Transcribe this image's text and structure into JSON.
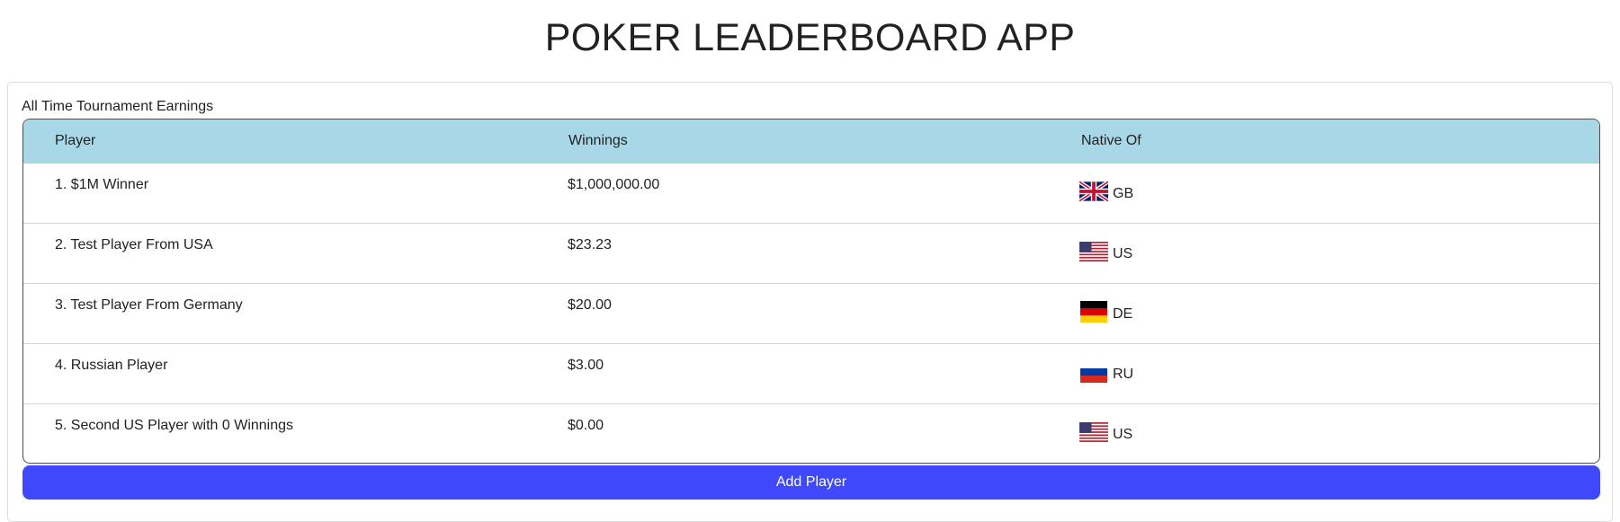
{
  "app": {
    "title": "POKER LEADERBOARD APP"
  },
  "leaderboard": {
    "caption": "All Time Tournament Earnings",
    "headers": {
      "player": "Player",
      "winnings": "Winnings",
      "native": "Native Of"
    },
    "rows": [
      {
        "player": "1. $1M Winner",
        "winnings": "$1,000,000.00",
        "country": "GB",
        "flag": "gb-flag-icon"
      },
      {
        "player": "2. Test Player From USA",
        "winnings": "$23.23",
        "country": "US",
        "flag": "us-flag-icon"
      },
      {
        "player": "3. Test Player From Germany",
        "winnings": "$20.00",
        "country": "DE",
        "flag": "de-flag-icon"
      },
      {
        "player": "4. Russian Player",
        "winnings": "$3.00",
        "country": "RU",
        "flag": "ru-flag-icon"
      },
      {
        "player": "5. Second US Player with 0 Winnings",
        "winnings": "$0.00",
        "country": "US",
        "flag": "us-flag-icon"
      }
    ],
    "add_button_label": "Add Player"
  },
  "colors": {
    "header_bg": "#a8d8e8",
    "button_bg": "#3f48fb",
    "button_text": "#ffffff"
  }
}
